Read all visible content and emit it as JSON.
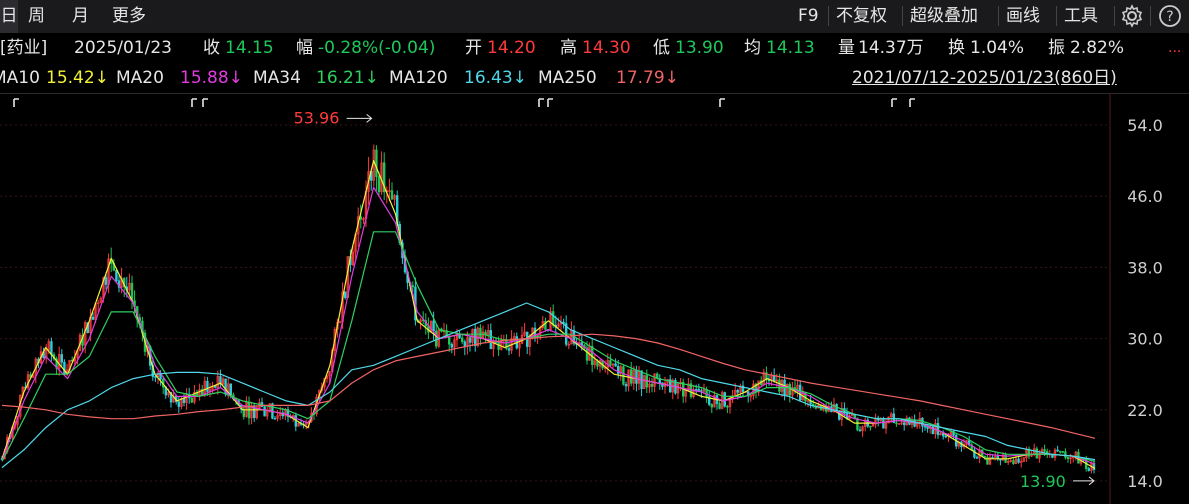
{
  "tabs": {
    "day": "日",
    "week": "周",
    "month": "月",
    "more": "更多"
  },
  "toolbar": {
    "f9": "F9",
    "no_adjust": "不复权",
    "super_overlay": "超级叠加",
    "draw_line": "画线",
    "tools": "工具"
  },
  "info": {
    "name": "[药业]",
    "date": "2025/01/23",
    "close_label": "收",
    "close": "14.15",
    "change_label": "幅",
    "change": "-0.28%(-0.04)",
    "open_label": "开",
    "open": "14.20",
    "high_label": "高",
    "high": "14.30",
    "low_label": "低",
    "low": "13.90",
    "avg_label": "均",
    "avg": "14.13",
    "volume_label": "量",
    "volume": "14.37万",
    "turnover_label": "换",
    "turnover": "1.04%",
    "amplitude_label": "振",
    "amplitude": "2.82%",
    "more": "..."
  },
  "ma": {
    "ma10_label": "MA10",
    "ma10": "15.42↓",
    "ma20_label": "MA20",
    "ma20": "15.88↓",
    "ma34_label": "MA34",
    "ma34": "16.21↓",
    "ma120_label": "MA120",
    "ma120": "16.43↓",
    "ma250_label": "MA250",
    "ma250": "17.79↓",
    "range": "2021/07/12-2025/01/23(860日)"
  },
  "colors": {
    "up": "#ff3b3b",
    "down": "#1ec85a",
    "ma10": "#f2f23a",
    "ma20": "#e03ce0",
    "ma34": "#2ed060",
    "ma120": "#4fd8e8",
    "ma250": "#f06464",
    "grid": "#3a1515",
    "background": "#000000"
  },
  "chart_data": {
    "type": "line",
    "ylim": [
      14,
      55
    ],
    "yticks": [
      "54.0",
      "46.0",
      "38.0",
      "30.0",
      "22.0",
      "14.0"
    ],
    "annotations": {
      "max": "53.96",
      "min": "13.90"
    },
    "x": [
      0,
      2,
      4,
      6,
      8,
      10,
      12,
      14,
      16,
      18,
      20,
      22,
      24,
      26,
      28,
      30,
      32,
      34,
      36,
      38,
      40,
      42,
      44,
      46,
      48,
      50,
      52,
      54,
      56,
      58,
      60,
      62,
      64,
      66,
      68,
      70,
      72,
      74,
      76,
      78,
      80,
      82,
      84,
      86,
      88,
      90,
      92,
      94,
      96,
      98,
      100
    ],
    "series": [
      {
        "name": "MA10",
        "values": [
          16.5,
          24,
          29,
          26,
          32,
          39,
          34,
          26,
          23,
          24,
          25,
          22,
          22,
          21.5,
          20,
          27,
          40,
          50,
          44,
          32,
          30,
          30.5,
          30,
          29,
          30,
          32,
          30,
          28,
          26,
          25.5,
          25,
          24.5,
          23.5,
          23,
          24,
          25.5,
          24.5,
          23,
          22,
          20.5,
          20.5,
          20.8,
          20.5,
          19.5,
          18,
          16.5,
          16.5,
          17,
          17,
          16.8,
          15.4
        ]
      },
      {
        "name": "MA20",
        "values": [
          16.3,
          23,
          28,
          25.5,
          30,
          37,
          34,
          27,
          23.5,
          23.5,
          24.5,
          22.5,
          22,
          21.5,
          20.5,
          25,
          37,
          47,
          43,
          33,
          30,
          30.5,
          30,
          29.5,
          30,
          31,
          30,
          28.5,
          26.5,
          25.5,
          25,
          24.5,
          24,
          23,
          23.5,
          25,
          24.5,
          23.5,
          22,
          21,
          20.5,
          20.8,
          20.5,
          19.5,
          18.5,
          17,
          16.8,
          17,
          17,
          16.8,
          15.9
        ]
      },
      {
        "name": "MA34",
        "values": [
          16.2,
          21,
          26,
          26,
          28,
          33,
          33,
          28,
          24,
          23.5,
          24,
          23,
          22.5,
          22,
          21,
          23,
          32,
          42,
          42,
          36,
          31,
          30.5,
          30.5,
          29.8,
          30,
          30.5,
          30.5,
          29,
          27.5,
          26.5,
          25.5,
          25,
          24.5,
          23.5,
          23.5,
          24.5,
          24.5,
          23.8,
          22.5,
          21.5,
          21,
          21,
          20.8,
          20,
          19,
          17.5,
          17,
          17,
          17,
          16.8,
          16.2
        ]
      },
      {
        "name": "MA120",
        "values": [
          15.5,
          17.5,
          20,
          22,
          23,
          24.5,
          25.5,
          26,
          26.2,
          26.2,
          26,
          25,
          24,
          23,
          22.5,
          24,
          26.5,
          27,
          28,
          29,
          30,
          31,
          32,
          33,
          34,
          33,
          31,
          30,
          29,
          28,
          27,
          26.5,
          25.5,
          25,
          24.5,
          24,
          23.5,
          22.5,
          22,
          21.5,
          21,
          21,
          20.5,
          20,
          19.5,
          19,
          18,
          17.5,
          17,
          16.8,
          16.4
        ]
      },
      {
        "name": "MA250",
        "values": [
          22.5,
          22.3,
          22,
          21.5,
          21.2,
          21,
          21,
          21.3,
          21.5,
          21.8,
          22,
          22.3,
          22.5,
          22.5,
          22.5,
          23,
          25,
          26.5,
          27.5,
          28,
          28.5,
          29,
          29.5,
          29.8,
          30,
          30.2,
          30.3,
          30.5,
          30.3,
          30,
          29.5,
          28.8,
          28,
          27.2,
          26.5,
          26,
          25.5,
          25,
          24.6,
          24.2,
          23.8,
          23.4,
          23,
          22.5,
          22,
          21.5,
          21,
          20.5,
          20,
          19.4,
          18.8
        ]
      }
    ]
  }
}
